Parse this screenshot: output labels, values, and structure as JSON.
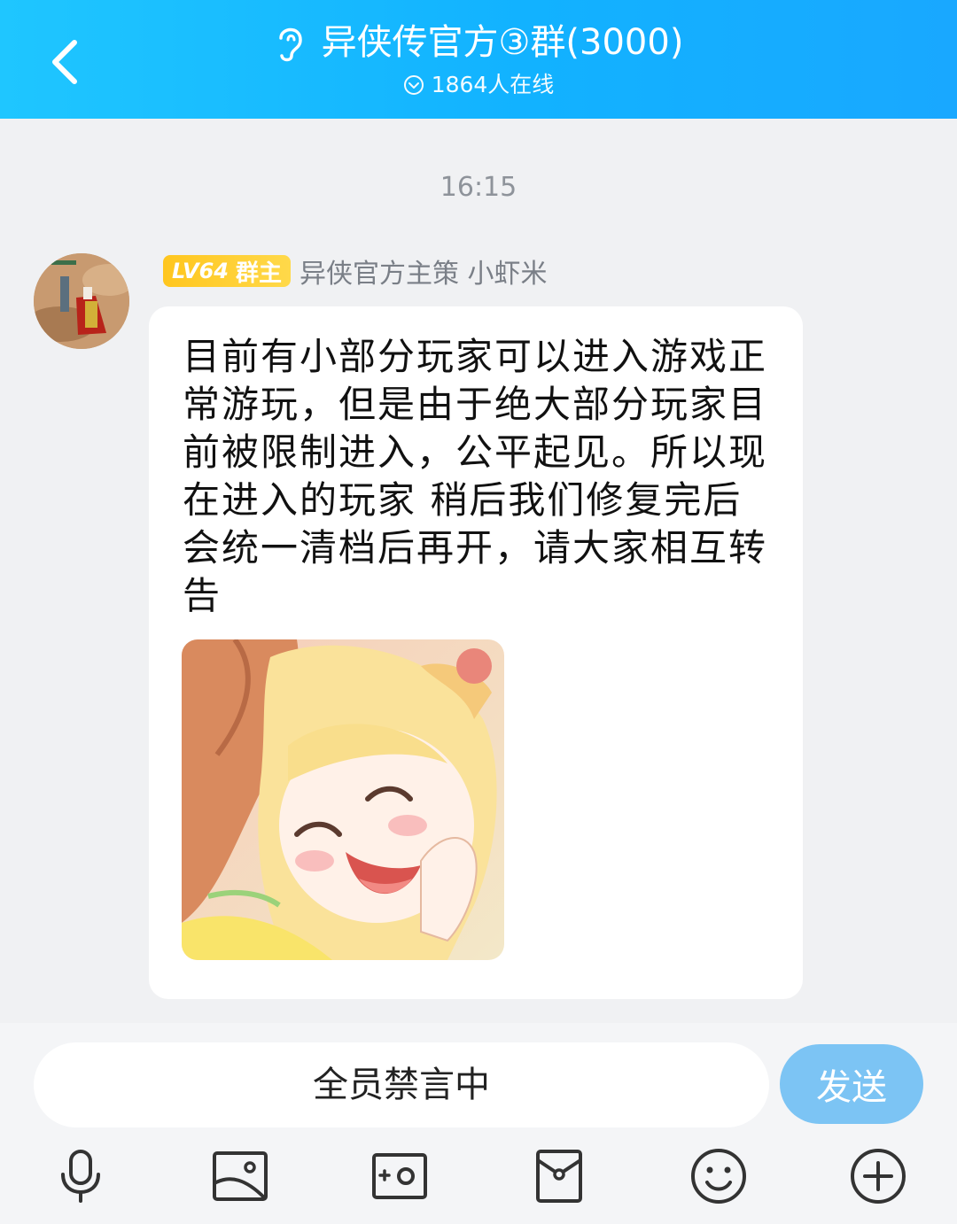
{
  "header": {
    "title": "异侠传官方③群(3000)",
    "online": "1864人在线"
  },
  "chat": {
    "timestamp": "16:15",
    "message": {
      "level": "LV64",
      "role": "群主",
      "sender": "异侠官方主策 小虾米",
      "text": "目前有小部分玩家可以进入游戏正常游玩，但是由于绝大部分玩家目前被限制进入，公平起见。所以现在进入的玩家 稍后我们修复完后会统一清档后再开，请大家相互转告"
    }
  },
  "input": {
    "placeholder": "全员禁言中",
    "send_label": "发送"
  },
  "toolbar": {
    "icons": [
      "microphone-icon",
      "image-icon",
      "camera-icon",
      "red-packet-icon",
      "emoji-icon",
      "plus-icon"
    ]
  },
  "colors": {
    "header_start": "#1fc6ff",
    "header_end": "#19a8ff",
    "badge": "#ffc61e",
    "send_button": "#7cc4f4"
  }
}
